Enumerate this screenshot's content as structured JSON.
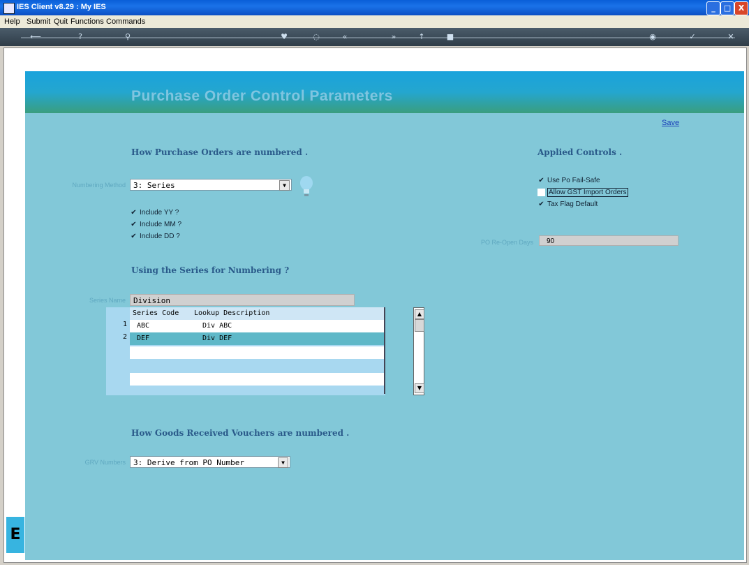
{
  "window": {
    "title": "IES Client v8.29 : My IES",
    "min": "_",
    "max": "□",
    "close": "X"
  },
  "menu": [
    "Help",
    "Submit",
    "Quit",
    "Functions",
    "Commands"
  ],
  "toolbar_icons": [
    "back-arrow-icon",
    "help-icon",
    "search-icon",
    "heart-icon",
    "circle-icon",
    "rewind-icon",
    "forward-icon",
    "up-icon",
    "square-icon",
    "camera-icon",
    "check-icon",
    "close-icon"
  ],
  "header": {
    "title": "Purchase Order Control Parameters"
  },
  "save_label": "Save",
  "numbering": {
    "heading": "How Purchase Orders are numbered .",
    "method_label": "Numbering Method",
    "method_value": "3: Series",
    "include_yy": "Include YY ?",
    "include_mm": "Include MM ?",
    "include_dd": "Include DD ?"
  },
  "applied": {
    "heading": "Applied Controls .",
    "fail_safe": "Use Po Fail-Safe",
    "gst_import": "Allow GST Import Orders",
    "tax_flag": "Tax Flag Default",
    "days_label": "PO Re-Open Days",
    "days_value": "90"
  },
  "series": {
    "heading": "Using the Series for Numbering ?",
    "name_label": "Series Name",
    "name_value": "Division",
    "col_code": "Series Code",
    "col_desc": "Lookup Description",
    "rows": [
      {
        "num": "1",
        "code": "ABC",
        "desc": "Div ABC"
      },
      {
        "num": "2",
        "code": "DEF",
        "desc": "Div DEF"
      }
    ]
  },
  "grv": {
    "heading": "How Goods Received Vouchers are numbered .",
    "label": "GRV Numbers",
    "value": "3: Derive from PO Number"
  },
  "left_badge": "E"
}
